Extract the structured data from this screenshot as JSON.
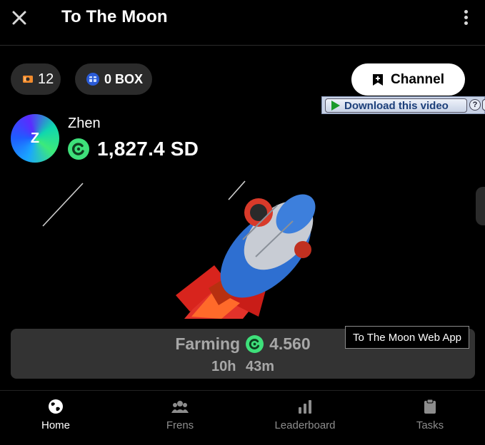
{
  "header": {
    "title": "To The Moon",
    "close_icon": "close-icon",
    "menu_icon": "more-vertical-icon"
  },
  "stats": {
    "tickets": "12",
    "tickets_icon": "ticket-icon",
    "box": "0 BOX",
    "box_icon": "box-icon"
  },
  "channel_button": {
    "label": "Channel",
    "icon": "bookmark-plus-icon"
  },
  "download_bar": {
    "label": "Download this video",
    "help": "?"
  },
  "user": {
    "avatar_letter": "Z",
    "name": "Zhen",
    "balance": "1,827.4 SD",
    "coin_icon": "coin-icon"
  },
  "farming": {
    "label": "Farming",
    "value": "4.560",
    "time_hours": "10h",
    "time_minutes": "43m"
  },
  "tooltip": "To The Moon Web App",
  "nav": {
    "items": [
      {
        "label": "Home",
        "icon": "globe-icon",
        "active": true
      },
      {
        "label": "Frens",
        "icon": "people-icon",
        "active": false
      },
      {
        "label": "Leaderboard",
        "icon": "bar-chart-icon",
        "active": false
      },
      {
        "label": "Tasks",
        "icon": "clipboard-icon",
        "active": false
      }
    ]
  },
  "colors": {
    "background": "#000000",
    "pill": "#2b2b2b",
    "coin": "#3ee07a",
    "farm_panel": "#333333",
    "inactive": "#8d8d8d",
    "rocket_body": "#2e6fd1",
    "rocket_flame": "#e2322a"
  }
}
